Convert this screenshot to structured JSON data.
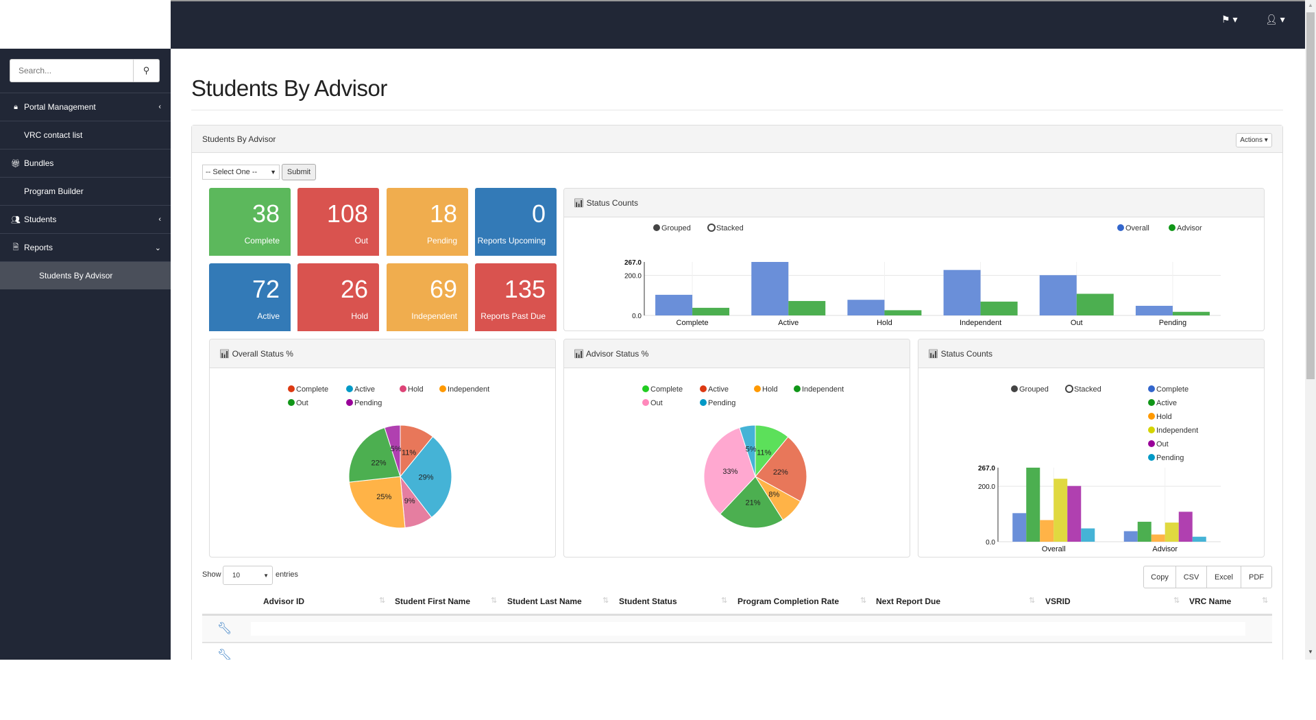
{
  "topbar": {
    "flag_icon": "flag-icon",
    "user_icon": "user-icon"
  },
  "sidebar": {
    "search_placeholder": "Search...",
    "items": [
      {
        "label": "Portal Management",
        "icon": "lock-icon",
        "chevron": "‹"
      },
      {
        "label": "VRC contact list"
      },
      {
        "label": "Bundles",
        "icon": "gift-icon"
      },
      {
        "label": "Program Builder"
      },
      {
        "label": "Students",
        "icon": "users-icon",
        "chevron": "‹"
      },
      {
        "label": "Reports",
        "icon": "file-icon",
        "chevron": "⌄"
      },
      {
        "label": "Students By Advisor",
        "active": true
      }
    ]
  },
  "page": {
    "title": "Students By Advisor"
  },
  "panel": {
    "title": "Students By Advisor",
    "actions_label": "Actions ▾",
    "select_value": "-- Select One --",
    "submit_label": "Submit"
  },
  "tiles": [
    {
      "value": "38",
      "label": "Complete",
      "color": "#5cb85c"
    },
    {
      "value": "108",
      "label": "Out",
      "color": "#d9534f"
    },
    {
      "value": "18",
      "label": "Pending",
      "color": "#f0ad4e"
    },
    {
      "value": "0",
      "label": "Reports Upcoming",
      "color": "#337ab7"
    },
    {
      "value": "72",
      "label": "Active",
      "color": "#337ab7"
    },
    {
      "value": "26",
      "label": "Hold",
      "color": "#d9534f"
    },
    {
      "value": "69",
      "label": "Independent",
      "color": "#f0ad4e"
    },
    {
      "value": "135",
      "label": "Reports Past Due",
      "color": "#d9534f"
    }
  ],
  "chart_data": [
    {
      "type": "bar",
      "title": "Status Counts",
      "mode_options": [
        "Grouped",
        "Stacked"
      ],
      "mode_selected": "Grouped",
      "categories": [
        "Complete",
        "Active",
        "Hold",
        "Independent",
        "Out",
        "Pending"
      ],
      "series": [
        {
          "name": "Overall",
          "values": [
            103,
            267,
            78,
            227,
            201,
            48
          ],
          "color": "#3366cc"
        },
        {
          "name": "Advisor",
          "values": [
            38,
            72,
            26,
            69,
            108,
            18
          ],
          "color": "#109618"
        }
      ],
      "yticks": [
        "0.0",
        "200.0",
        "267.0"
      ],
      "ylim": [
        0,
        267
      ],
      "legend": "top-right",
      "grid": true
    },
    {
      "type": "pie",
      "title": "Overall Status %",
      "categories": [
        "Complete",
        "Active",
        "Hold",
        "Independent",
        "Out",
        "Pending"
      ],
      "values": [
        11,
        29,
        9,
        25,
        22,
        5
      ],
      "labels": [
        "11%",
        "29%",
        "9%",
        "25%",
        "22%",
        "5%"
      ],
      "colors": [
        "#dc3912",
        "#0099c6",
        "#dd4477",
        "#ff9900",
        "#109618",
        "#990099"
      ],
      "legend": "top"
    },
    {
      "type": "pie",
      "title": "Advisor Status %",
      "categories": [
        "Complete",
        "Active",
        "Hold",
        "Independent",
        "Out",
        "Pending"
      ],
      "values": [
        11,
        22,
        8,
        21,
        33,
        5
      ],
      "labels": [
        "11%",
        "22%",
        "8%",
        "21%",
        "33%",
        "5%"
      ],
      "colors": [
        "#22cc22",
        "#dc3912",
        "#ff9900",
        "#109618",
        "#ff88bb",
        "#0099c6"
      ],
      "legend": "top"
    },
    {
      "type": "bar",
      "title": "Status Counts",
      "mode_options": [
        "Grouped",
        "Stacked"
      ],
      "mode_selected": "Grouped",
      "categories": [
        "Overall",
        "Advisor"
      ],
      "series": [
        {
          "name": "Complete",
          "values": [
            103,
            38
          ],
          "color": "#3366cc"
        },
        {
          "name": "Active",
          "values": [
            267,
            72
          ],
          "color": "#109618"
        },
        {
          "name": "Hold",
          "values": [
            78,
            26
          ],
          "color": "#ff9900"
        },
        {
          "name": "Independent",
          "values": [
            227,
            69
          ],
          "color": "#d4d400"
        },
        {
          "name": "Out",
          "values": [
            201,
            108
          ],
          "color": "#990099"
        },
        {
          "name": "Pending",
          "values": [
            48,
            18
          ],
          "color": "#0099c6"
        }
      ],
      "yticks": [
        "0.0",
        "200.0",
        "267.0"
      ],
      "ylim": [
        0,
        267
      ],
      "legend": "right",
      "grid": true
    }
  ],
  "table": {
    "show_label": "Show",
    "entries_value": "10",
    "entries_label": "entries",
    "export_buttons": [
      "Copy",
      "CSV",
      "Excel",
      "PDF"
    ],
    "columns": [
      "Advisor ID",
      "Student First Name",
      "Student Last Name",
      "Student Status",
      "Program Completion Rate",
      "Next Report Due",
      "VSRID",
      "VRC Name"
    ],
    "row_icon": "wrench-icon"
  }
}
